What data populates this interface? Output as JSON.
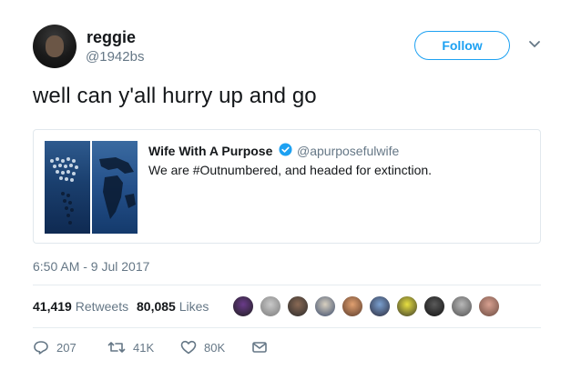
{
  "author": {
    "display_name": "reggie",
    "handle": "@1942bs",
    "follow_label": "Follow"
  },
  "tweet": {
    "text": "well can y'all hurry up and go",
    "timestamp": "6:50 AM - 9 Jul 2017"
  },
  "quoted_tweet": {
    "display_name": "Wife With A Purpose",
    "handle": "@apurposefulwife",
    "text": "We are #Outnumbered, and headed for extinction."
  },
  "stats": {
    "retweets_count": "41,419",
    "retweets_label": "Retweets",
    "likes_count": "80,085",
    "likes_label": "Likes"
  },
  "actions": {
    "reply_count": "207",
    "retweet_count": "41K",
    "like_count": "80K"
  },
  "colors": {
    "accent": "#1da1f2",
    "verified": "#1da1f2",
    "secondary_text": "#657786"
  },
  "icons": {
    "chevron": "chevron-down-icon",
    "verified": "verified-badge-icon",
    "reply": "reply-icon",
    "retweet": "retweet-icon",
    "like": "heart-icon",
    "message": "envelope-icon"
  }
}
